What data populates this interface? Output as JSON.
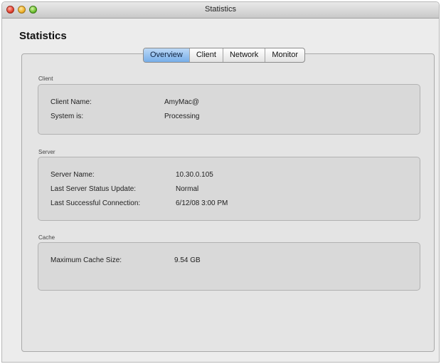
{
  "window": {
    "title": "Statistics"
  },
  "page_title": "Statistics",
  "tabs": [
    {
      "label": "Overview",
      "active": true
    },
    {
      "label": "Client",
      "active": false
    },
    {
      "label": "Network",
      "active": false
    },
    {
      "label": "Monitor",
      "active": false
    }
  ],
  "client": {
    "group_label": "Client",
    "rows": [
      {
        "label": "Client Name:",
        "value": "AmyMac@"
      },
      {
        "label": "System is:",
        "value": "Processing"
      }
    ]
  },
  "server": {
    "group_label": "Server",
    "rows": [
      {
        "label": "Server Name:",
        "value": "10.30.0.105"
      },
      {
        "label": "Last Server Status Update:",
        "value": "Normal"
      },
      {
        "label": "Last Successful Connection:",
        "value": "6/12/08 3:00 PM"
      }
    ]
  },
  "cache": {
    "group_label": "Cache",
    "rows": [
      {
        "label": "Maximum Cache Size:",
        "value": "9.54 GB"
      }
    ]
  },
  "colors": {
    "active_tab": "#77aee9",
    "window_bg": "#ececec",
    "box_bg": "#d9d9d9"
  }
}
